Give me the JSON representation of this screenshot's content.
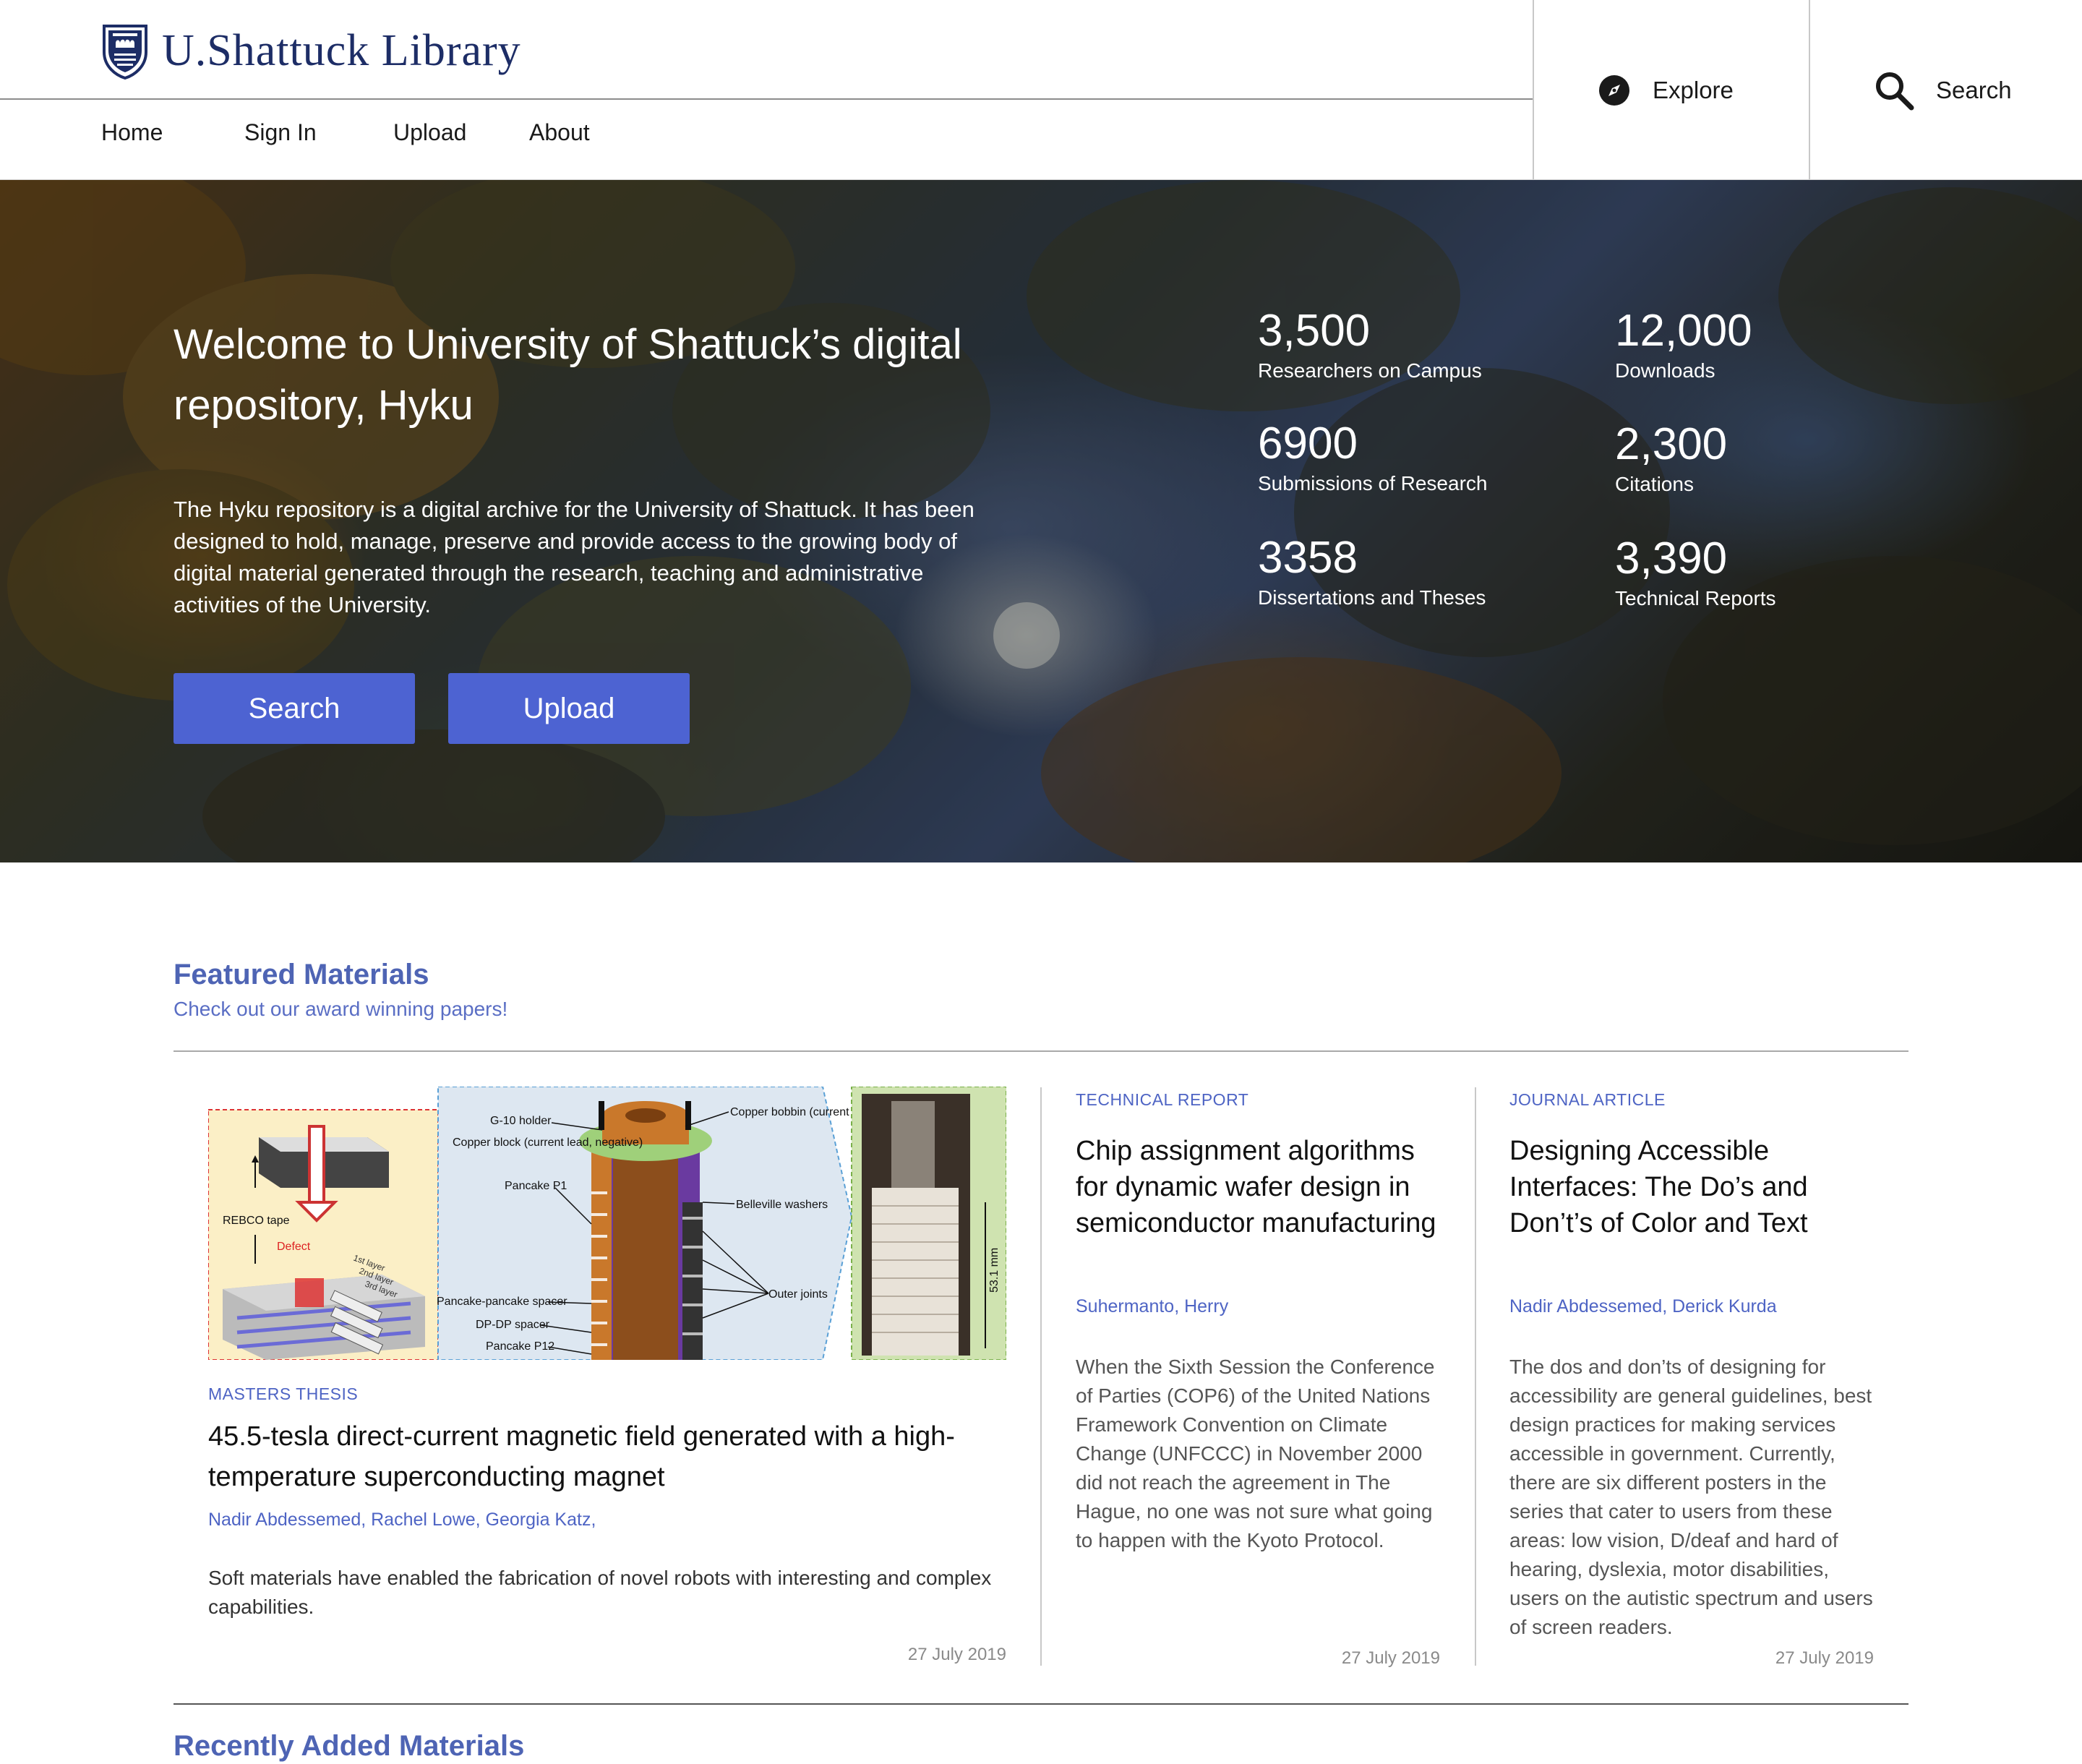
{
  "header": {
    "brand": "U.Shattuck Library",
    "nav": [
      "Home",
      "Sign In",
      "Upload",
      "About"
    ],
    "explore_label": "Explore",
    "search_label": "Search"
  },
  "hero": {
    "title": "Welcome to University of Shattuck’s digital repository, Hyku",
    "description": "The Hyku repository is a digital archive for the University of Shattuck. It has been designed to hold, manage, preserve and provide access to the growing body of digital material generated through the research, teaching and administrative activities of the University.",
    "buttons": {
      "search": "Search",
      "upload": "Upload"
    },
    "stats": [
      {
        "value": "3,500",
        "label": "Researchers on Campus"
      },
      {
        "value": "12,000",
        "label": "Downloads"
      },
      {
        "value": "6900",
        "label": "Submissions of Research"
      },
      {
        "value": "2,300",
        "label": "Citations"
      },
      {
        "value": "3358",
        "label": "Dissertations and Theses"
      },
      {
        "value": "3,390",
        "label": "Technical Reports"
      }
    ]
  },
  "featured": {
    "title": "Featured Materials",
    "subtitle": "Check out our award winning papers!",
    "cards": [
      {
        "type": "MASTERS THESIS",
        "title": "45.5-tesla direct-current magnetic field generated with a high-temperature superconducting magnet",
        "authors": "Nadir Abdessemed, Rachel Lowe, Georgia Katz,",
        "body": "Soft materials have enabled the fabrication of novel robots with interesting and complex capabilities.",
        "date": "27 July 2019",
        "figure_labels": [
          "G-10 holder",
          "Copper block (current lead, negative)",
          "Pancake P1",
          "REBCO tape",
          "Defect",
          "1st layer",
          "2nd layer",
          "3rd layer",
          "Copper bobbin (current lead, positive)",
          "Belleville washers",
          "Outer joints",
          "Pancake-pancake spacer",
          "DP-DP spacer",
          "Pancake P12",
          "53.1 mm"
        ]
      },
      {
        "type": "TECHNICAL REPORT",
        "title": "Chip assignment algorithms for dynamic wafer design in semiconductor manufacturing",
        "authors": "Suhermanto, Herry",
        "body": "When the Sixth Session the Conference of Parties (COP6) of the United Nations Framework Convention on Climate Change (UNFCCC) in November 2000 did not reach the agreement in The Hague, no one was not sure what going to happen with the Kyoto Protocol.",
        "date": "27 July 2019"
      },
      {
        "type": "JOURNAL ARTICLE",
        "title": "Designing Accessible Interfaces: The Do’s and Don’t’s of Color and Text",
        "authors": "Nadir Abdessemed, Derick Kurda",
        "body": "The dos and don’ts of designing for accessibility are general guidelines, best design practices for making services accessible in government. Currently, there are six different posters in the series that cater to users from these areas: low vision, D/deaf and hard of hearing, dyslexia, motor disabilities, users on the autistic spectrum and users of screen readers.",
        "date": "27 July 2019"
      }
    ]
  },
  "recent": {
    "title": "Recently Added Materials"
  },
  "colors": {
    "brand": "#1d2d66",
    "accent": "#4d63d2",
    "link": "#4e64c4"
  },
  "icons": {
    "logo": "shield-crest-icon",
    "explore": "compass-icon",
    "search": "search-icon"
  }
}
